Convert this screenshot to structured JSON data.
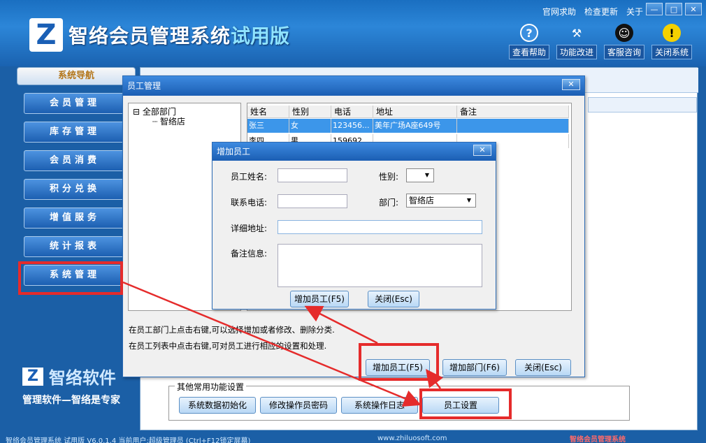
{
  "header": {
    "logo_mark": "Z",
    "title": "智络会员管理系统",
    "edition": "试用版",
    "links": [
      "官网求助",
      "检查更新",
      "关于"
    ],
    "window_controls": [
      "—",
      "□",
      "✕"
    ],
    "quick_buttons": [
      {
        "label": "查看帮助",
        "icon": "?"
      },
      {
        "label": "功能改进",
        "icon": "⚒"
      },
      {
        "label": "客服咨询",
        "icon": "☺"
      },
      {
        "label": "关闭系统",
        "icon": "!"
      }
    ]
  },
  "sidebar": {
    "title": "系统导航",
    "items": [
      "会员管理",
      "库存管理",
      "会员消费",
      "积分兑换",
      "增值服务",
      "统计报表",
      "系统管理"
    ],
    "brand_name": "智络软件",
    "brand_slogan": "管理软件—智络是专家"
  },
  "main": {
    "other_functions_title": "其他常用功能设置",
    "other_functions": [
      "系统数据初始化",
      "修改操作员密码",
      "系统操作日志",
      "员工设置"
    ]
  },
  "employee_dialog": {
    "title": "员工管理",
    "close": "✕",
    "tree_root": "全部部门",
    "tree_child": "智络店",
    "columns": [
      "姓名",
      "性别",
      "电话",
      "地址",
      "备注"
    ],
    "rows": [
      [
        "张三",
        "女",
        "123456...",
        "美年广场A座649号",
        ""
      ],
      [
        "李四",
        "男",
        "159692...",
        "",
        ""
      ]
    ],
    "info_line1": "在员工部门上点击右键,可以选择增加或者修改、删除分类.",
    "info_line2": "在员工列表中点击右键,可对员工进行相应的设置和处理.",
    "btn_add_employee": "增加员工(F5)",
    "btn_add_department": "增加部门(F6)",
    "btn_close": "关闭(Esc)"
  },
  "add_employee_dialog": {
    "title": "增加员工",
    "close": "✕",
    "name_label": "员工姓名:",
    "name_value": "",
    "gender_label": "性别:",
    "gender_value": "",
    "phone_label": "联系电话:",
    "phone_value": "",
    "department_label": "部门:",
    "department_value": "智络店",
    "address_label": "详细地址:",
    "address_value": "",
    "note_label": "备注信息:",
    "note_value": "",
    "btn_add": "增加员工(F5)",
    "btn_close": "关闭(Esc)"
  },
  "statusbar": {
    "text": "智络会员管理系统 试用版 V6.0.1.4 当前用户:超级管理员 (Ctrl+F12锁定屏幕)",
    "url": "www.zhiluosoft.com",
    "brand": "智络会员管理系统"
  },
  "colors": {
    "annotation_red": "#e52b2b",
    "header_blue": "#1a6fc1",
    "selected_row": "#3c96ea"
  }
}
